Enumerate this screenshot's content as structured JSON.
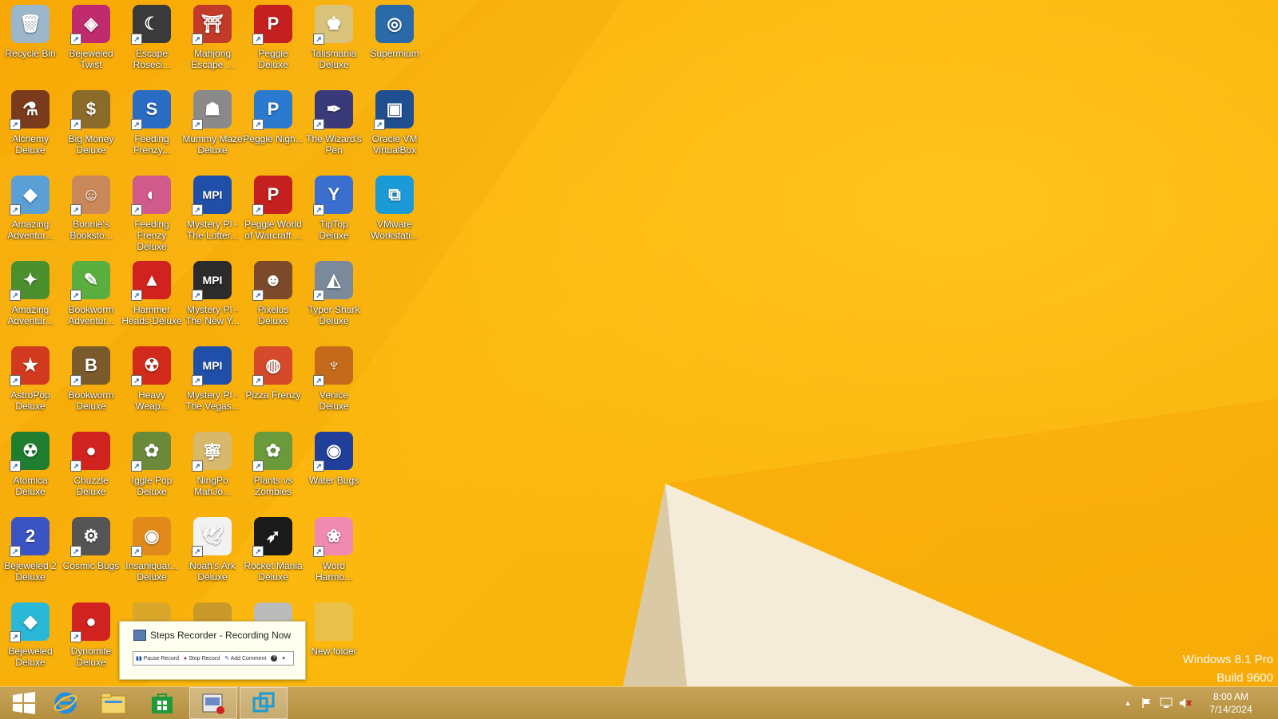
{
  "desktop": {
    "icons": [
      {
        "label": "Recycle Bin",
        "icon": "recycle-bin-icon",
        "color": "#9bb7c9",
        "glyph": "🗑",
        "shortcut": false
      },
      {
        "label": "Alchemy Deluxe",
        "icon": "alchemy-deluxe-icon",
        "color": "#7a3b1c",
        "glyph": "⚗",
        "shortcut": true
      },
      {
        "label": "Amazing Adventur...",
        "icon": "amazing-adventures-icon",
        "color": "#5aa0d6",
        "glyph": "◆",
        "shortcut": true
      },
      {
        "label": "Amazing Adventur...",
        "icon": "amazing-adventures-2-icon",
        "color": "#4c8f2f",
        "glyph": "✦",
        "shortcut": true
      },
      {
        "label": "AstroPop Deluxe",
        "icon": "astropop-icon",
        "color": "#d23a1f",
        "glyph": "★",
        "shortcut": true
      },
      {
        "label": "Atomica Deluxe",
        "icon": "atomica-icon",
        "color": "#1e7d2e",
        "glyph": "☢",
        "shortcut": true
      },
      {
        "label": "Bejeweled 2 Deluxe",
        "icon": "bejeweled-2-icon",
        "color": "#3b54c4",
        "glyph": "2",
        "shortcut": true
      },
      {
        "label": "Bejeweled Deluxe",
        "icon": "bejeweled-icon",
        "color": "#2ab8d8",
        "glyph": "◆",
        "shortcut": true
      },
      {
        "label": "Bejeweled Twist",
        "icon": "bejeweled-twist-icon",
        "color": "#c02b6e",
        "glyph": "◈",
        "shortcut": true
      },
      {
        "label": "Big Money Deluxe",
        "icon": "big-money-icon",
        "color": "#8a6b2a",
        "glyph": "$",
        "shortcut": true
      },
      {
        "label": "Bonnie's Booksto...",
        "icon": "bonnies-bookstore-icon",
        "color": "#c9885a",
        "glyph": "☺",
        "shortcut": true
      },
      {
        "label": "Bookworm Adventur...",
        "icon": "bookworm-adventures-icon",
        "color": "#5aae3f",
        "glyph": "✎",
        "shortcut": true
      },
      {
        "label": "Bookworm Deluxe",
        "icon": "bookworm-deluxe-icon",
        "color": "#7b5a2b",
        "glyph": "B",
        "shortcut": true
      },
      {
        "label": "Chuzzle Deluxe",
        "icon": "chuzzle-icon",
        "color": "#d0231f",
        "glyph": "●",
        "shortcut": true
      },
      {
        "label": "Cosmic Bugs",
        "icon": "cosmic-bugs-icon",
        "color": "#555555",
        "glyph": "⚙",
        "shortcut": true
      },
      {
        "label": "Dynomite Deluxe",
        "icon": "dynomite-icon",
        "color": "#d0231f",
        "glyph": "●",
        "shortcut": true
      },
      {
        "label": "Escape Roseci...",
        "icon": "escape-rosecliff-icon",
        "color": "#3a3a3a",
        "glyph": "☾",
        "shortcut": true
      },
      {
        "label": "Feeding Frenzy...",
        "icon": "feeding-frenzy-icon",
        "color": "#2a6cc4",
        "glyph": "S",
        "shortcut": true
      },
      {
        "label": "Feeding Frenzy Deluxe",
        "icon": "feeding-frenzy-deluxe-icon",
        "color": "#d05a8a",
        "glyph": "◐",
        "shortcut": true
      },
      {
        "label": "Hammer Heads Deluxe",
        "icon": "hammer-heads-icon",
        "color": "#d0231f",
        "glyph": "▲",
        "shortcut": true
      },
      {
        "label": "Heavy Weap...",
        "icon": "heavy-weapon-icon",
        "color": "#d22a1a",
        "glyph": "☢",
        "shortcut": true
      },
      {
        "label": "Iggle Pop Deluxe",
        "icon": "iggle-pop-icon",
        "color": "#6a8a3a",
        "glyph": "✿",
        "shortcut": true
      },
      {
        "label": "Insaniquar... Deluxe",
        "icon": "insaniquarium-icon",
        "color": "#e08a1a",
        "glyph": "◉",
        "shortcut": true
      },
      {
        "label": "",
        "icon": "folder-partial-icon",
        "color": "#d9a72a",
        "glyph": "",
        "shortcut": false
      },
      {
        "label": "Mahjong Escape ...",
        "icon": "mahjong-escape-icon",
        "color": "#c23a2a",
        "glyph": "⛩",
        "shortcut": true
      },
      {
        "label": "Mummy Maze Deluxe",
        "icon": "mummy-maze-icon",
        "color": "#8a8a8a",
        "glyph": "☗",
        "shortcut": true
      },
      {
        "label": "Mystery PI - The Lotter...",
        "icon": "mystery-pi-lottery-icon",
        "color": "#1f4fa8",
        "glyph": "MPI",
        "shortcut": true
      },
      {
        "label": "Mystery PI - The New Y...",
        "icon": "mystery-pi-new-york-icon",
        "color": "#2b2b2b",
        "glyph": "MPI",
        "shortcut": true
      },
      {
        "label": "Mystery PI - The Vegas...",
        "icon": "mystery-pi-vegas-icon",
        "color": "#1f4fa8",
        "glyph": "MPI",
        "shortcut": true
      },
      {
        "label": "NingPo MahJo...",
        "icon": "ningpo-mahjong-icon",
        "color": "#d8b86a",
        "glyph": "寧",
        "shortcut": true
      },
      {
        "label": "Noah's Ark Deluxe",
        "icon": "noahs-ark-icon",
        "color": "#f2f2f2",
        "glyph": "🕊",
        "shortcut": true
      },
      {
        "label": "",
        "icon": "partial-icon",
        "color": "#c99a2a",
        "glyph": "",
        "shortcut": false
      },
      {
        "label": "Peggle Deluxe",
        "icon": "peggle-icon",
        "color": "#c42020",
        "glyph": "P",
        "shortcut": true
      },
      {
        "label": "Peggle Nigh...",
        "icon": "peggle-nights-icon",
        "color": "#2a7ad0",
        "glyph": "P",
        "shortcut": true
      },
      {
        "label": "Peggle World of Warcraft ...",
        "icon": "peggle-wow-icon",
        "color": "#c42020",
        "glyph": "P",
        "shortcut": true
      },
      {
        "label": "Pixelus Deluxe",
        "icon": "pixelus-icon",
        "color": "#7a4a2a",
        "glyph": "☻",
        "shortcut": true
      },
      {
        "label": "Pizza Frenzy",
        "icon": "pizza-frenzy-icon",
        "color": "#d44a2a",
        "glyph": "◍",
        "shortcut": true
      },
      {
        "label": "Plants vs Zombies",
        "icon": "plants-vs-zombies-icon",
        "color": "#6a9a3a",
        "glyph": "✿",
        "shortcut": true
      },
      {
        "label": "Rocket Mania Deluxe",
        "icon": "rocket-mania-icon",
        "color": "#1a1a1a",
        "glyph": "➶",
        "shortcut": true
      },
      {
        "label": "",
        "icon": "partial-icon-2",
        "color": "#bbbbbb",
        "glyph": "",
        "shortcut": false
      },
      {
        "label": "Talismania Deluxe",
        "icon": "talismania-icon",
        "color": "#d9c27a",
        "glyph": "♚",
        "shortcut": true
      },
      {
        "label": "The Wizard's Pen",
        "icon": "wizards-pen-icon",
        "color": "#3a3a7a",
        "glyph": "✒",
        "shortcut": true
      },
      {
        "label": "TipTop Deluxe",
        "icon": "tiptop-icon",
        "color": "#3a6fd0",
        "glyph": "Y",
        "shortcut": true
      },
      {
        "label": "Typer Shark Deluxe",
        "icon": "typer-shark-icon",
        "color": "#7a8a9a",
        "glyph": "◭",
        "shortcut": true
      },
      {
        "label": "Venice Deluxe",
        "icon": "venice-icon",
        "color": "#c46a1a",
        "glyph": "♆",
        "shortcut": true
      },
      {
        "label": "Water Bugs",
        "icon": "water-bugs-icon",
        "color": "#1f3f9a",
        "glyph": "◉",
        "shortcut": true
      },
      {
        "label": "Word Harmo...",
        "icon": "word-harmony-icon",
        "color": "#f08ab0",
        "glyph": "❀",
        "shortcut": true
      },
      {
        "label": "New folder",
        "icon": "folder-icon",
        "color": "#e8c04a",
        "glyph": "",
        "shortcut": false
      },
      {
        "label": "Supermium",
        "icon": "supermium-icon",
        "color": "#2a6aa8",
        "glyph": "◎",
        "shortcut": false
      },
      {
        "label": "Oracle VM VirtualBox",
        "icon": "virtualbox-icon",
        "color": "#1f4f8f",
        "glyph": "▣",
        "shortcut": true
      },
      {
        "label": "VMware Workstati...",
        "icon": "vmware-icon",
        "color": "#1a9ad6",
        "glyph": "⧉",
        "shortcut": false
      }
    ]
  },
  "watermark": {
    "line1": "Windows 8.1 Pro",
    "line2": "Build 9600"
  },
  "steps_popup": {
    "title": "Steps Recorder - Recording Now",
    "pause": "Pause Record",
    "stop": "Stop Record",
    "comment": "Add Comment",
    "help": "?"
  },
  "taskbar": {
    "items": [
      {
        "name": "start-button",
        "icon": "windows-logo-icon"
      },
      {
        "name": "internet-explorer-button",
        "icon": "internet-explorer-icon"
      },
      {
        "name": "file-explorer-button",
        "icon": "file-explorer-icon"
      },
      {
        "name": "store-button",
        "icon": "store-icon"
      },
      {
        "name": "steps-recorder-button",
        "icon": "steps-recorder-icon"
      },
      {
        "name": "vmware-button",
        "icon": "vmware-icon"
      }
    ],
    "tray_chevron": "▲",
    "clock_time": "8:00 AM",
    "clock_date": "7/14/2024"
  }
}
